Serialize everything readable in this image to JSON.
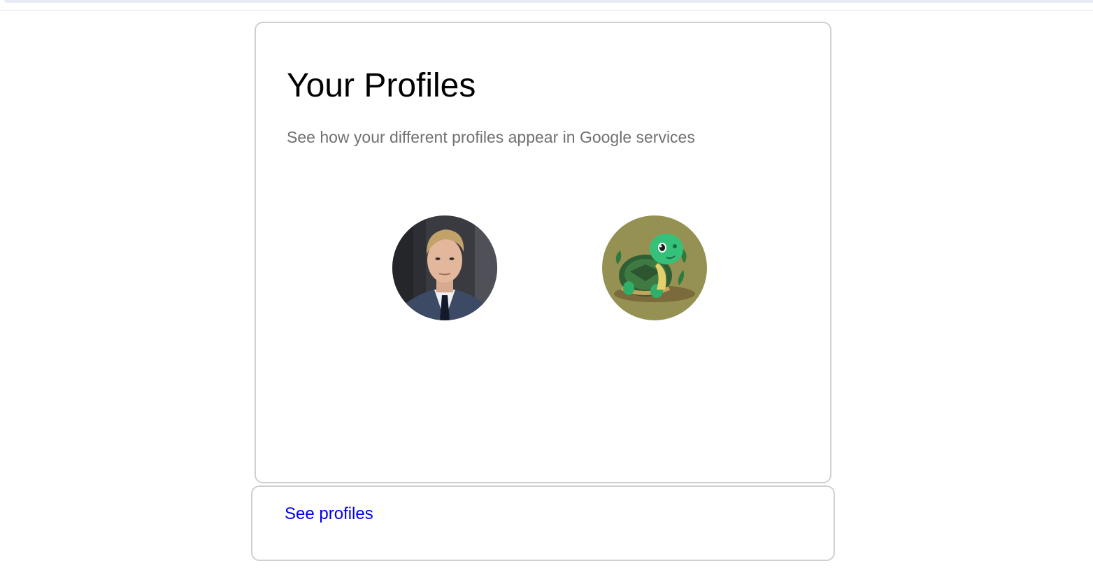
{
  "card": {
    "title": "Your Profiles",
    "subtitle": "See how your different profiles appear in Google services"
  },
  "profiles": [
    {
      "icon": "man-in-suit-avatar-icon",
      "bg_color": "#2b2b30"
    },
    {
      "icon": "cartoon-turtle-avatar-icon",
      "bg_color": "#949152"
    }
  ],
  "footer": {
    "link_label": "See profiles",
    "link_color": "#0000ee"
  }
}
